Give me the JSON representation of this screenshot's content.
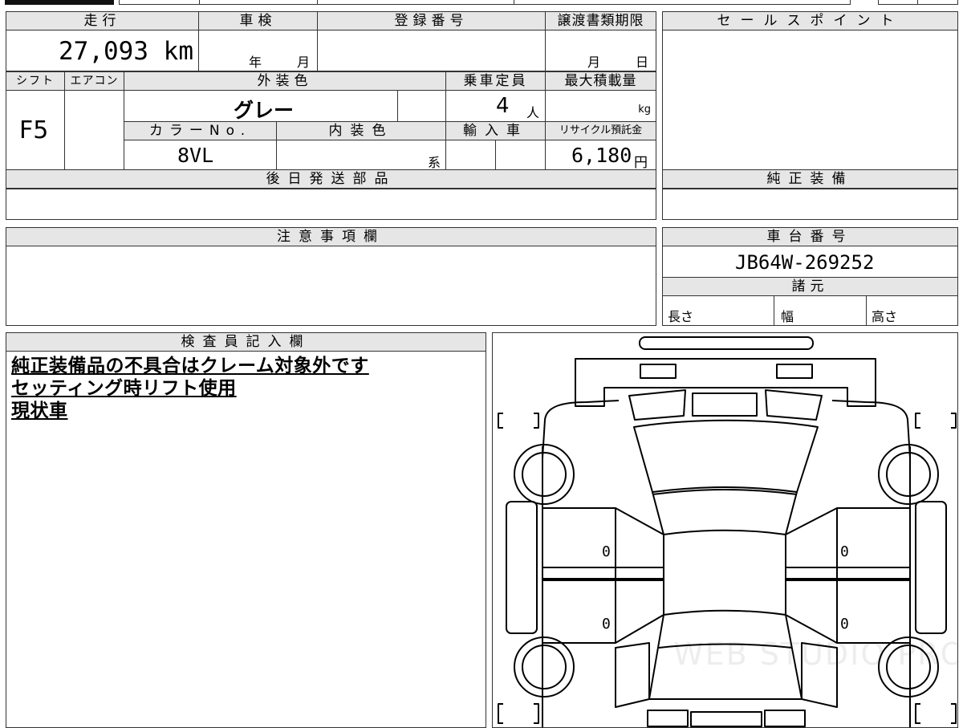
{
  "headers": {
    "mileage": "走行",
    "inspection": "車検",
    "registration_no": "登録番号",
    "transfer_deadline": "譲渡書類期限",
    "sales_point": "セールスポイント",
    "shift": "シフト",
    "aircon": "エアコン",
    "exterior_color": "外装色",
    "capacity": "乗車定員",
    "max_load": "最大積載量",
    "color_no": "カラーNo.",
    "interior_color": "内装色",
    "import": "輸入車",
    "recycle_fee": "リサイクル預託金",
    "later_parts": "後日発送部品",
    "genuine_equipment": "純正装備",
    "notes": "注意事項欄",
    "chassis_no": "車台番号",
    "specs": "諸元",
    "inspector_notes": "検査員記入欄"
  },
  "values": {
    "mileage": "27,093 km",
    "inspection_year_unit": "年",
    "inspection_month_unit": "月",
    "transfer_month_unit": "月",
    "transfer_day_unit": "日",
    "shift": "F5",
    "exterior_color": "グレー",
    "capacity_num": "4",
    "capacity_unit": "人",
    "max_load_unit": "kg",
    "color_no": "8VL",
    "interior_suffix": "系",
    "recycle_amount": "6,180",
    "recycle_unit": "円",
    "chassis_no": "JB64W-269252",
    "spec_length": "長さ",
    "spec_width": "幅",
    "spec_height": "高さ"
  },
  "inspector_remarks": [
    "純正装備品の不具合はクレーム対象外です",
    "セッティング時リフト使用",
    "現状車"
  ],
  "diagram": {
    "left_front_door_mark": "0",
    "left_rear_door_mark": "0",
    "right_front_door_mark": "0",
    "right_rear_door_mark": "0",
    "watermark": "WEB STUDIO PRO"
  }
}
